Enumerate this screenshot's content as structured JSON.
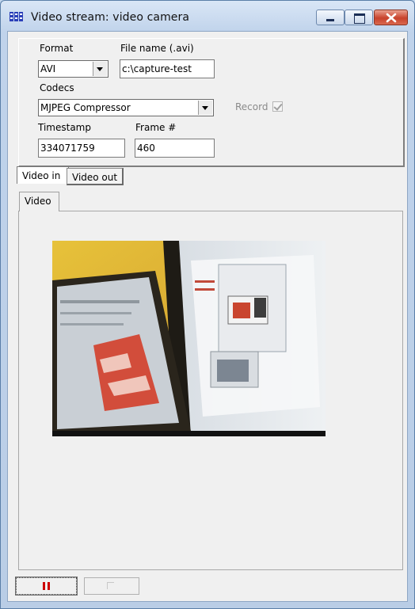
{
  "window": {
    "title": "Video stream: video camera"
  },
  "settings": {
    "format": {
      "label": "Format",
      "value": "AVI"
    },
    "file_name": {
      "label": "File name (.avi)",
      "value": "c:\\capture-test"
    },
    "codecs": {
      "label": "Codecs",
      "value": "MJPEG Compressor"
    },
    "record": {
      "label": "Record",
      "checked": true
    },
    "timestamp": {
      "label": "Timestamp",
      "value": "334071759"
    },
    "frame": {
      "label": "Frame #",
      "value": "460"
    }
  },
  "tabs": [
    "Video in",
    "Video out"
  ],
  "inner_tab": "Video",
  "controls": {
    "pause_icon": "pause-icon",
    "stop_icon": "stop-icon"
  },
  "colors": {
    "title_bar": "#c0d3eb",
    "close_button": "#c8422b",
    "pause": "#cc0000",
    "client": "#f0f0f0"
  }
}
